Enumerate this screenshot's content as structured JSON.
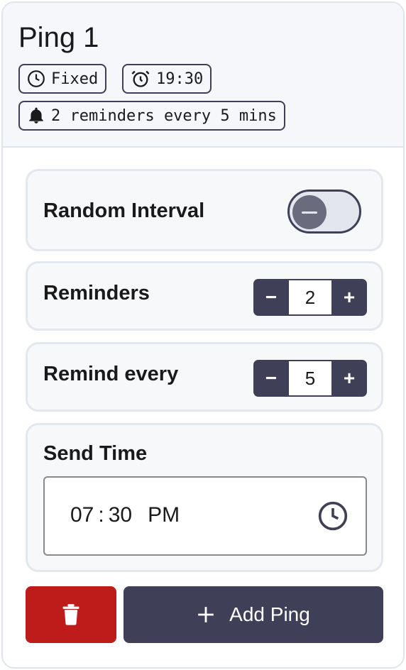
{
  "ping": {
    "title": "Ping 1",
    "chips": {
      "mode": {
        "icon": "clock-icon",
        "label": "Fixed"
      },
      "time": {
        "icon": "alarm-clock-icon",
        "label": "19:30"
      },
      "reminders": {
        "icon": "bell-icon",
        "label": "2 reminders every 5 mins"
      }
    }
  },
  "settings": {
    "random_interval": {
      "label": "Random Interval",
      "enabled": false,
      "knob_icon": "minus-icon"
    },
    "reminders": {
      "label": "Reminders",
      "value": "2",
      "decrement": "−",
      "increment": "+"
    },
    "remind_every": {
      "label": "Remind every",
      "value": "5",
      "decrement": "−",
      "increment": "+"
    },
    "send_time": {
      "label": "Send Time",
      "hours": "07",
      "separator": ":",
      "minutes": "30",
      "ampm": "PM",
      "icon": "clock-icon"
    }
  },
  "actions": {
    "delete_icon": "trash-icon",
    "add_icon": "plus-icon",
    "add_label": "Add Ping"
  },
  "colors": {
    "primary": "#3f3f57",
    "danger": "#be1b1b",
    "surface": "#f6f8fa",
    "border": "#e3e8ee"
  }
}
